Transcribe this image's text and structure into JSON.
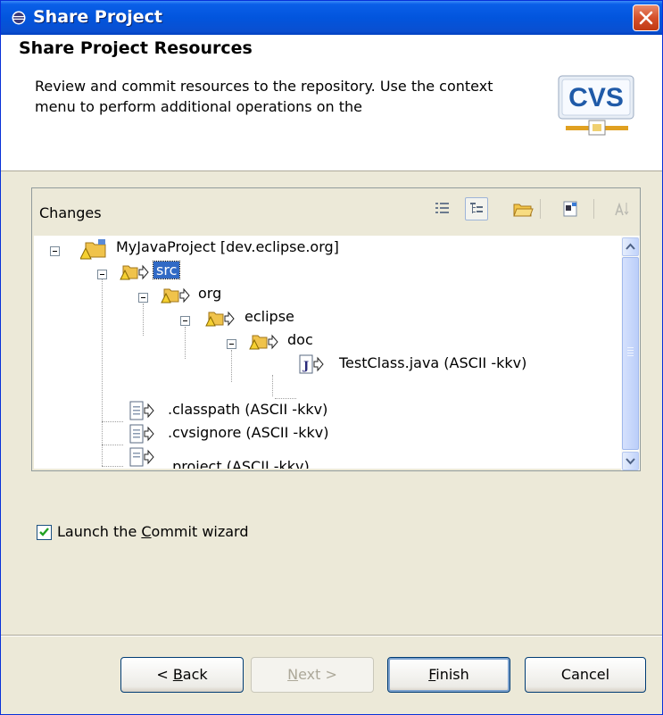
{
  "window": {
    "title": "Share Project"
  },
  "header": {
    "title": "Share Project Resources",
    "description": "Review and commit resources to the repository. Use the context menu to perform additional operations on the",
    "logo_text": "CVS"
  },
  "changes": {
    "label": "Changes",
    "toolbar": [
      "flat-list-icon",
      "tree-icon",
      "folder-icon",
      "collapse-all-icon",
      "sort-icon"
    ]
  },
  "tree": [
    {
      "label": "MyJavaProject   [dev.eclipse.org]"
    },
    {
      "label": "src"
    },
    {
      "label": "org"
    },
    {
      "label": "eclipse"
    },
    {
      "label": "doc"
    },
    {
      "label": "TestClass.java    (ASCII -kkv)"
    },
    {
      "label": ".classpath    (ASCII -kkv)"
    },
    {
      "label": ".cvsignore    (ASCII -kkv)"
    },
    {
      "label": ".project    (ASCII -kkv)"
    }
  ],
  "options": {
    "launch_commit_pre": "Launch the ",
    "launch_commit_mnemonic": "C",
    "launch_commit_post": "ommit wizard",
    "launch_commit_checked": true
  },
  "buttons": {
    "back_pre": "< ",
    "back_mnemonic": "B",
    "back_post": "ack",
    "next_mnemonic": "N",
    "next_post": "ext >",
    "finish_mnemonic": "F",
    "finish_post": "inish",
    "cancel": "Cancel"
  },
  "colors": {
    "titlebar": "#0255DD",
    "selection": "#316AC5",
    "face": "#ECE9D8"
  }
}
